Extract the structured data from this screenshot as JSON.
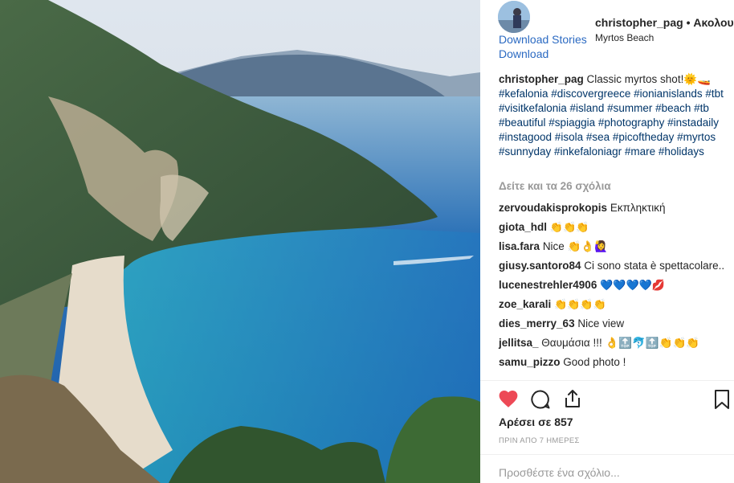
{
  "links": {
    "download_stories": "Download Stories",
    "download": "Download"
  },
  "header": {
    "username": "christopher_pag",
    "separator": " • ",
    "follow": "Ακολουθ",
    "location": "Myrtos Beach"
  },
  "caption": {
    "user": "christopher_pag",
    "text": "Classic myrtos shot!🌞🚤",
    "tags": "#kefalonia #discovergreece #ionianislands #tbt #visitkefalonia #island #summer #beach #tb #beautiful #spiaggia #photography #instadaily #instagood #isola #sea #picoftheday #myrtos #sunnyday #inkefaloniagr #mare #holidays"
  },
  "view_all_comments": "Δείτε και τα 26 σχόλια",
  "comments": [
    {
      "user": "zervoudakisprokopis",
      "text": "Εκπληκτική"
    },
    {
      "user": "giota_hdl",
      "text": "👏👏👏"
    },
    {
      "user": "lisa.fara",
      "text": "Nice 👏👌🙋‍♀️"
    },
    {
      "user": "giusy.santoro84",
      "text": "Ci sono stata è spettacolare.."
    },
    {
      "user": "lucenestrehler4906",
      "text": "💙💙💙💙💋"
    },
    {
      "user": "zoe_karali",
      "text": "👏👏👏👏"
    },
    {
      "user": "dies_merry_63",
      "text": "Nice view"
    },
    {
      "user": "jellitsa_",
      "text": "Θαυμάσια !!! 👌🔝🐬🔝👏👏👏"
    },
    {
      "user": "samu_pizzo",
      "text": "Good photo !"
    }
  ],
  "likes": "Αρέσει σε 857",
  "date": "ΠΡΙΝ ΑΠΟ 7 ΗΜΕΡΕΣ",
  "add_comment": {
    "placeholder": "Προσθέστε ένα σχόλιο..."
  },
  "icons": {
    "like": "heart-icon",
    "comment": "comment-icon",
    "share": "share-icon",
    "save": "bookmark-icon"
  },
  "colors": {
    "heart": "#ed4956",
    "link": "#003569"
  }
}
